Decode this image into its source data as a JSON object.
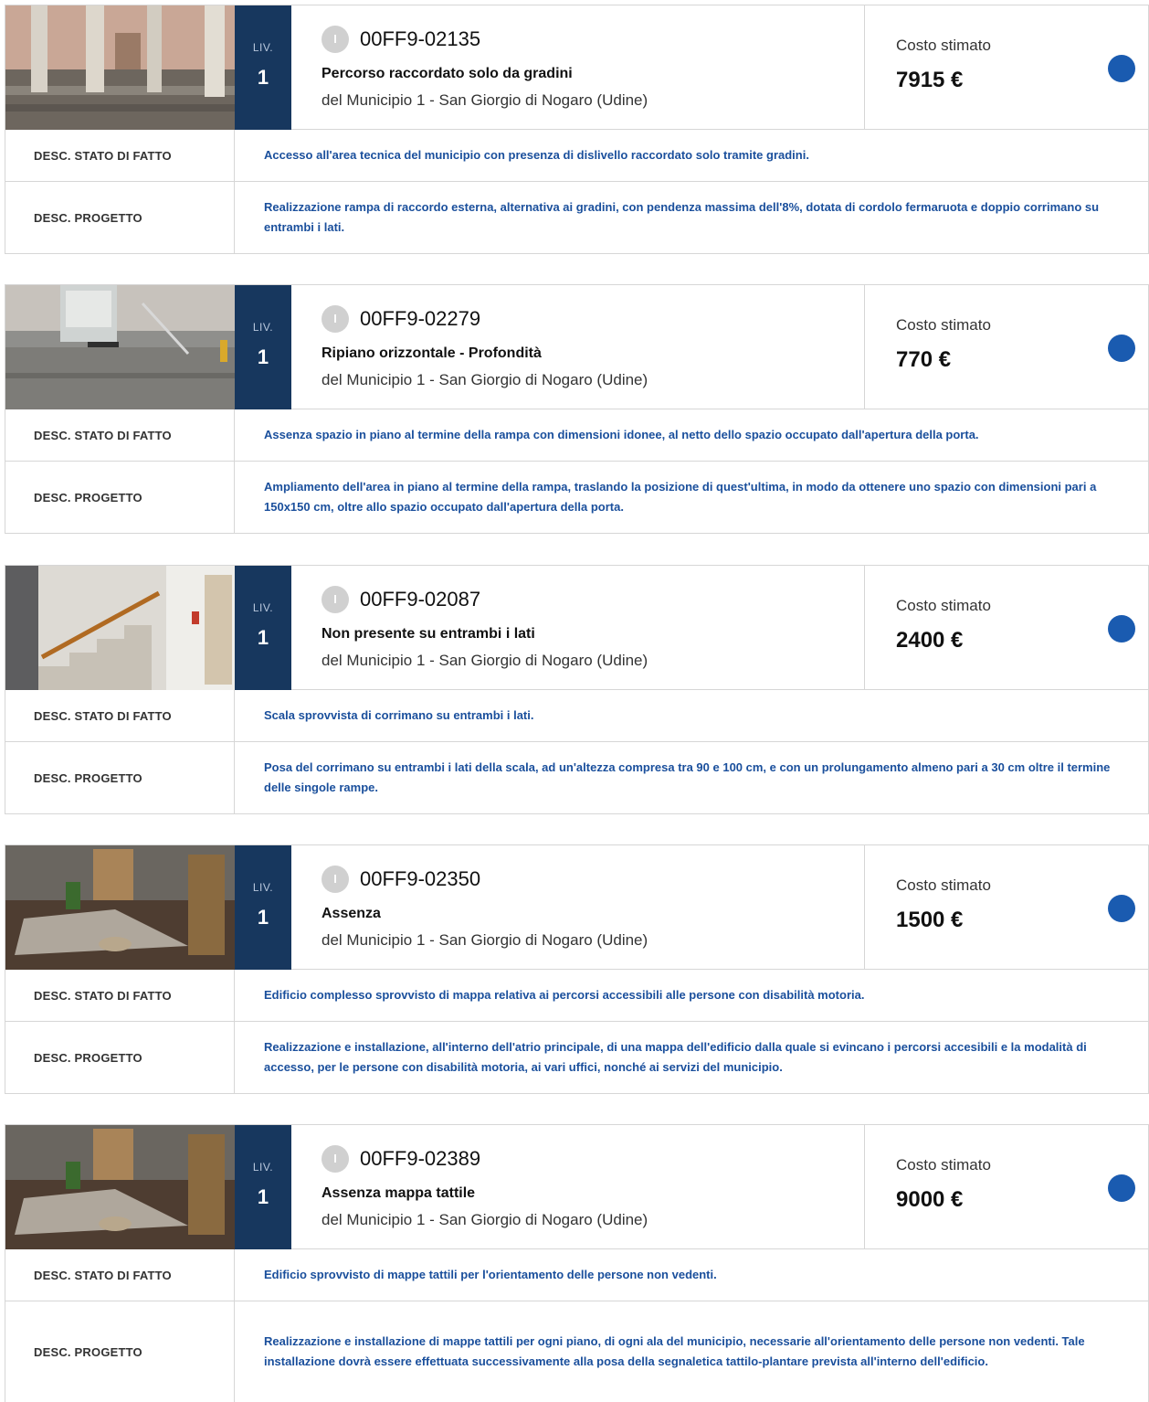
{
  "cards": [
    {
      "level_label": "LIV.",
      "level": "1",
      "badge": "I",
      "code": "00FF9-02135",
      "title": "Percorso raccordato solo da gradini",
      "subtitle": "del Municipio 1 - San Giorgio di Nogaro (Udine)",
      "cost_label": "Costo stimato",
      "cost": "7915 €",
      "stato_label": "DESC. STATO DI FATTO",
      "stato": "Accesso all'area tecnica del municipio con presenza di dislivello raccordato solo tramite gradini.",
      "progetto_label": "DESC. PROGETTO",
      "progetto": "Realizzazione rampa di raccordo esterna, alternativa ai gradini, con pendenza massima dell'8%, dotata di cordolo fermaruota e doppio corrimano su entrambi i lati."
    },
    {
      "level_label": "LIV.",
      "level": "1",
      "badge": "I",
      "code": "00FF9-02279",
      "title": "Ripiano orizzontale - Profondità",
      "subtitle": "del Municipio 1 - San Giorgio di Nogaro (Udine)",
      "cost_label": "Costo stimato",
      "cost": "770 €",
      "stato_label": "DESC. STATO DI FATTO",
      "stato": "Assenza spazio in piano al termine della rampa con dimensioni idonee, al netto dello spazio occupato dall'apertura della porta.",
      "progetto_label": "DESC. PROGETTO",
      "progetto": "Ampliamento dell'area in piano al termine della rampa, traslando la posizione di quest'ultima, in modo da ottenere uno spazio con dimensioni pari a 150x150 cm, oltre allo spazio occupato dall'apertura della porta."
    },
    {
      "level_label": "LIV.",
      "level": "1",
      "badge": "I",
      "code": "00FF9-02087",
      "title": "Non presente su entrambi i lati",
      "subtitle": "del Municipio 1 - San Giorgio di Nogaro (Udine)",
      "cost_label": "Costo stimato",
      "cost": "2400 €",
      "stato_label": "DESC. STATO DI FATTO",
      "stato": "Scala sprovvista di corrimano su entrambi i lati.",
      "progetto_label": "DESC. PROGETTO",
      "progetto": "Posa del corrimano su entrambi i lati della scala, ad un'altezza compresa tra 90 e 100 cm, e con un prolungamento almeno pari a 30 cm oltre il termine delle singole rampe."
    },
    {
      "level_label": "LIV.",
      "level": "1",
      "badge": "I",
      "code": "00FF9-02350",
      "title": "Assenza",
      "subtitle": "del Municipio 1 - San Giorgio di Nogaro (Udine)",
      "cost_label": "Costo stimato",
      "cost": "1500 €",
      "stato_label": "DESC. STATO DI FATTO",
      "stato": "Edificio complesso sprovvisto di mappa relativa ai percorsi accessibili alle persone con disabilità motoria.",
      "progetto_label": "DESC. PROGETTO",
      "progetto": "Realizzazione e installazione, all'interno dell'atrio principale, di una mappa dell'edificio dalla quale si evincano i percorsi accesibili e la modalità di accesso, per le persone con disabilità motoria, ai vari uffici, nonché ai servizi del municipio."
    },
    {
      "level_label": "LIV.",
      "level": "1",
      "badge": "I",
      "code": "00FF9-02389",
      "title": "Assenza mappa tattile",
      "subtitle": "del Municipio 1 - San Giorgio di Nogaro (Udine)",
      "cost_label": "Costo stimato",
      "cost": "9000 €",
      "stato_label": "DESC. STATO DI FATTO",
      "stato": "Edificio sprovvisto di mappe tattili per l'orientamento delle persone non vedenti.",
      "progetto_label": "DESC. PROGETTO",
      "progetto": "Realizzazione e installazione di mappe tattili per ogni piano, di ogni ala del municipio, necessarie all'orientamento delle persone non vedenti. Tale installazione dovrà essere effettuata successivamente alla posa della segnaletica tattilo-plantare prevista all'interno dell'edificio."
    }
  ],
  "colors": {
    "level_bg": "#17375e",
    "accent_text": "#1a4f9c",
    "status_dot": "#1a5bb0"
  }
}
